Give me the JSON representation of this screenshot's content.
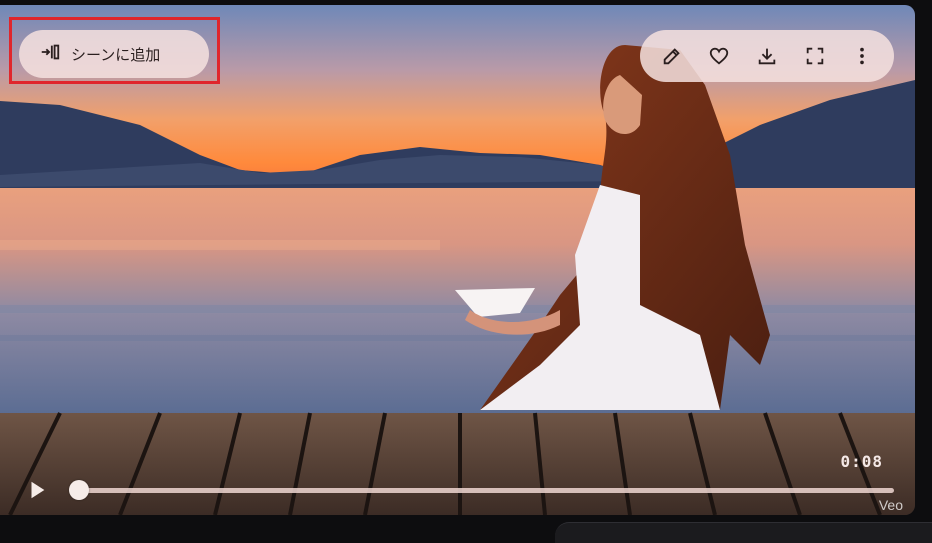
{
  "player": {
    "add_scene_label": "シーンに追加",
    "time": "0:08",
    "watermark": "Veo",
    "progress": 0.0
  },
  "toolbar": {
    "items": [
      "pencil-icon",
      "heart-icon",
      "download-icon",
      "fullscreen-icon",
      "more-vert-icon"
    ]
  },
  "colors": {
    "pill_bg": "#f5e1de",
    "highlight": "#e0262c"
  }
}
